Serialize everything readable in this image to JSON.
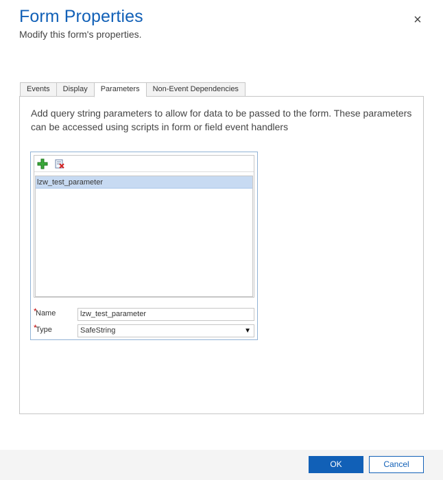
{
  "dialog": {
    "title": "Form Properties",
    "subtitle": "Modify this form's properties.",
    "close_glyph": "×"
  },
  "tabs": [
    {
      "label": "Events",
      "active": false
    },
    {
      "label": "Display",
      "active": false
    },
    {
      "label": "Parameters",
      "active": true
    },
    {
      "label": "Non-Event Dependencies",
      "active": false
    }
  ],
  "parameters": {
    "description": "Add query string parameters to allow for data to be passed to the form. These parameters can be accessed using scripts in form or field event handlers",
    "toolbar": {
      "add_icon": "add-icon",
      "delete_icon": "delete-icon"
    },
    "list": [
      "lzw_test_parameter"
    ],
    "name_label": "Name",
    "name_value": "lzw_test_parameter",
    "type_label": "Type",
    "type_value": "SafeString",
    "required_mark": "*"
  },
  "footer": {
    "ok_label": "OK",
    "cancel_label": "Cancel"
  },
  "colors": {
    "accent": "#1160b7",
    "selected_row": "#c7daf2",
    "required": "#c00000"
  }
}
